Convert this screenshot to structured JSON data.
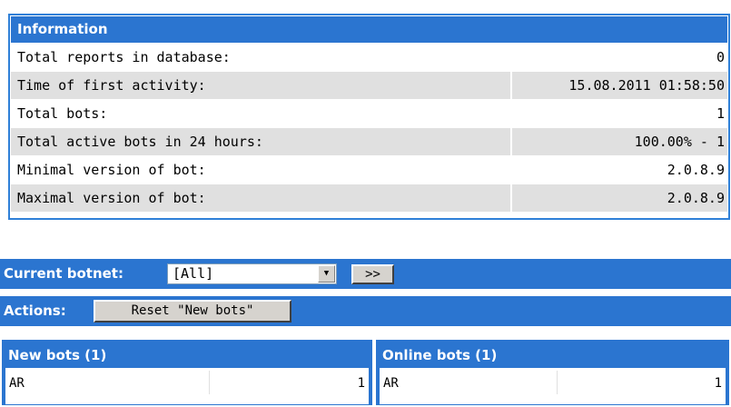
{
  "info": {
    "title": "Information",
    "rows": [
      {
        "label": "Total reports in database:",
        "value": "0"
      },
      {
        "label": "Time of first activity:",
        "value": "15.08.2011 01:58:50"
      },
      {
        "label": "Total bots:",
        "value": "1"
      },
      {
        "label": "Total active bots in 24 hours:",
        "value": "100.00% - 1"
      },
      {
        "label": "Minimal version of bot:",
        "value": "2.0.8.9"
      },
      {
        "label": "Maximal version of bot:",
        "value": "2.0.8.9"
      }
    ]
  },
  "botnet": {
    "label": "Current botnet:",
    "selected": "[All]",
    "go_label": ">>"
  },
  "actions": {
    "label": "Actions:",
    "reset_label": "Reset \"New bots\""
  },
  "new_bots": {
    "title": "New bots (1)",
    "rows": [
      {
        "country": "AR",
        "count": "1"
      }
    ]
  },
  "online_bots": {
    "title": "Online bots (1)",
    "rows": [
      {
        "country": "AR",
        "count": "1"
      }
    ]
  },
  "colors": {
    "header_blue": "#2b75d0",
    "row_alt": "#e0e0e0",
    "button_face": "#d6d3ce"
  }
}
